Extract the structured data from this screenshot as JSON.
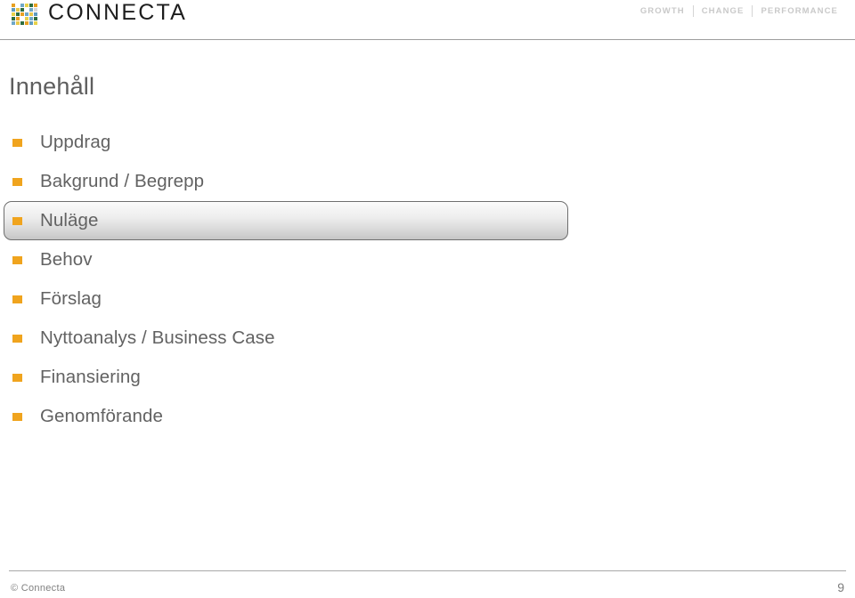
{
  "header": {
    "brand_name": "CONNECTA",
    "logo_icon": "connecta-pixel-grid-logo",
    "logo_colors": [
      "#e8a020",
      "#ffffff",
      "#6fa8c8",
      "#e8d24a",
      "#2f6e3f",
      "#e8a020",
      "#5f9bbf",
      "#e8c84a",
      "#2f6e3f",
      "#ffffff",
      "#6fa8c8",
      "#d8d8d8",
      "#e8d24a",
      "#2f6e3f",
      "#e8a020",
      "#6fa8c8",
      "#e8c84a",
      "#5f9bbf",
      "#2f6e3f",
      "#e8a020",
      "#ffffff",
      "#e8d24a",
      "#6fa8c8",
      "#2f6e3f",
      "#6fa8c8",
      "#e8c84a",
      "#2f6e3f",
      "#e8a020",
      "#5f9bbf",
      "#e8d24a"
    ],
    "tagline": {
      "word1": "GROWTH",
      "word2": "CHANGE",
      "word3": "PERFORMANCE"
    }
  },
  "title": "Innehåll",
  "agenda": {
    "items": [
      {
        "label": "Uppdrag",
        "highlighted": false
      },
      {
        "label": "Bakgrund / Begrepp",
        "highlighted": false
      },
      {
        "label": "Nuläge",
        "highlighted": true
      },
      {
        "label": "Behov",
        "highlighted": false
      },
      {
        "label": "Förslag",
        "highlighted": false
      },
      {
        "label": "Nyttoanalys / Business Case",
        "highlighted": false
      },
      {
        "label": "Finansiering",
        "highlighted": false
      },
      {
        "label": "Genomförande",
        "highlighted": false
      }
    ]
  },
  "footer": {
    "copyright": "© Connecta",
    "page_number": "9"
  },
  "colors": {
    "bullet_orange": "#f0a41e",
    "text_gray": "#626262",
    "title_gray": "#5e5e5e",
    "rule_gray": "#9c9c9c",
    "tagline_gray": "#c9c9c9"
  }
}
